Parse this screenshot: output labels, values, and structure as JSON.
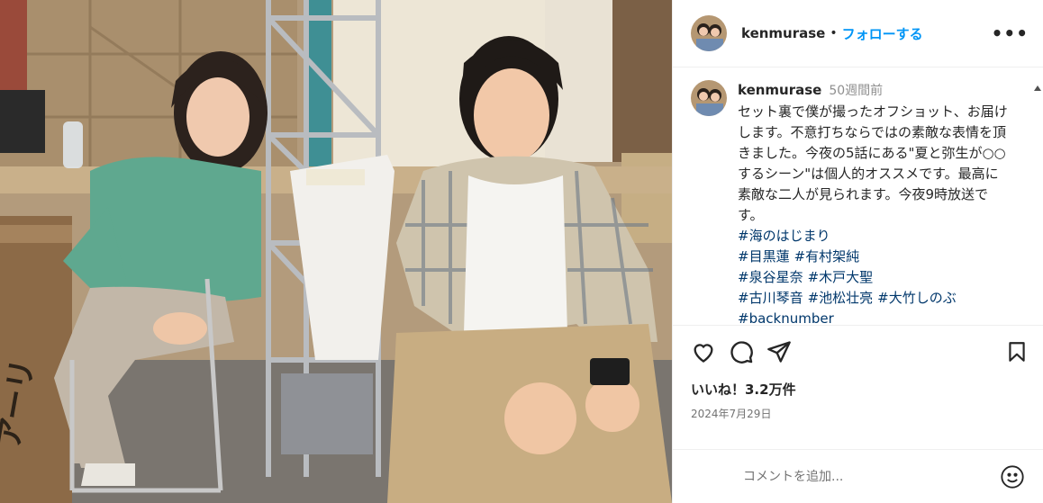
{
  "post": {
    "username": "kenmurase",
    "follow_label": "フォローする",
    "dot": "•",
    "more_label": "•••"
  },
  "caption": {
    "username": "kenmurase",
    "time": "50週間前",
    "text": "セット裏で僕が撮ったオフショット、お届けします。不意打ちならではの素敵な表情を頂きました。今夜の5話にある\"夏と弥生が○○するシーン\"は個人的オススメです。最高に素敵な二人が見られます。今夜9時放送です。",
    "hashtags": {
      "h1": "#海のはじまり",
      "h2": "#目黒蓮",
      "h3": "#有村架純",
      "h4": "#泉谷星奈",
      "h5": "#木戸大聖",
      "h6": "#古川琴音",
      "h7": "#池松壮亮",
      "h8": "#大竹しのぶ",
      "h9": "#backnumber"
    }
  },
  "engagement": {
    "likes": "いいね！3.2万件",
    "date": "2024年7月29日"
  },
  "comment_box": {
    "placeholder": "コメントを追加..."
  },
  "icons": {
    "like": "heart-icon",
    "comment": "comment-icon",
    "share": "share-icon",
    "save": "bookmark-icon",
    "emoji": "emoji-icon"
  },
  "colors": {
    "follow": "#0095f6",
    "hashtag": "#00376b",
    "muted": "#8e8e8e"
  }
}
